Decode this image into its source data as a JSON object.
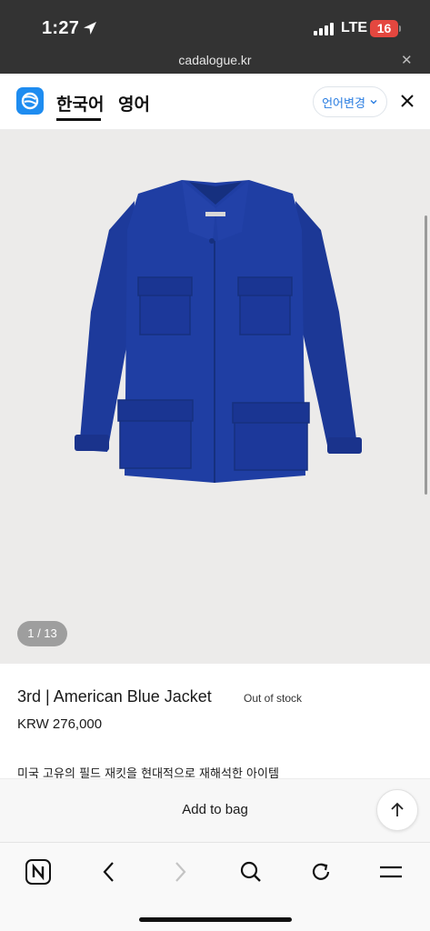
{
  "status_bar": {
    "time": "1:27",
    "network": "LTE",
    "battery": "16"
  },
  "browser": {
    "url": "cadalogue.kr"
  },
  "header": {
    "lang_korean": "한국어",
    "lang_english": "영어",
    "lang_change_label": "언어변경"
  },
  "gallery": {
    "counter": "1 / 13"
  },
  "product": {
    "title": "3rd | American Blue Jacket",
    "stock": "Out of stock",
    "price": "KRW 276,000",
    "description": "미국 고유의 필드 재킷을 현대적으로 재해석한 아이템"
  },
  "actions": {
    "add_to_bag": "Add to bag"
  },
  "colors": {
    "jacket_blue": "#1c3a9c",
    "brand_blue": "#1e8cf0",
    "battery_red": "#e4473f"
  }
}
